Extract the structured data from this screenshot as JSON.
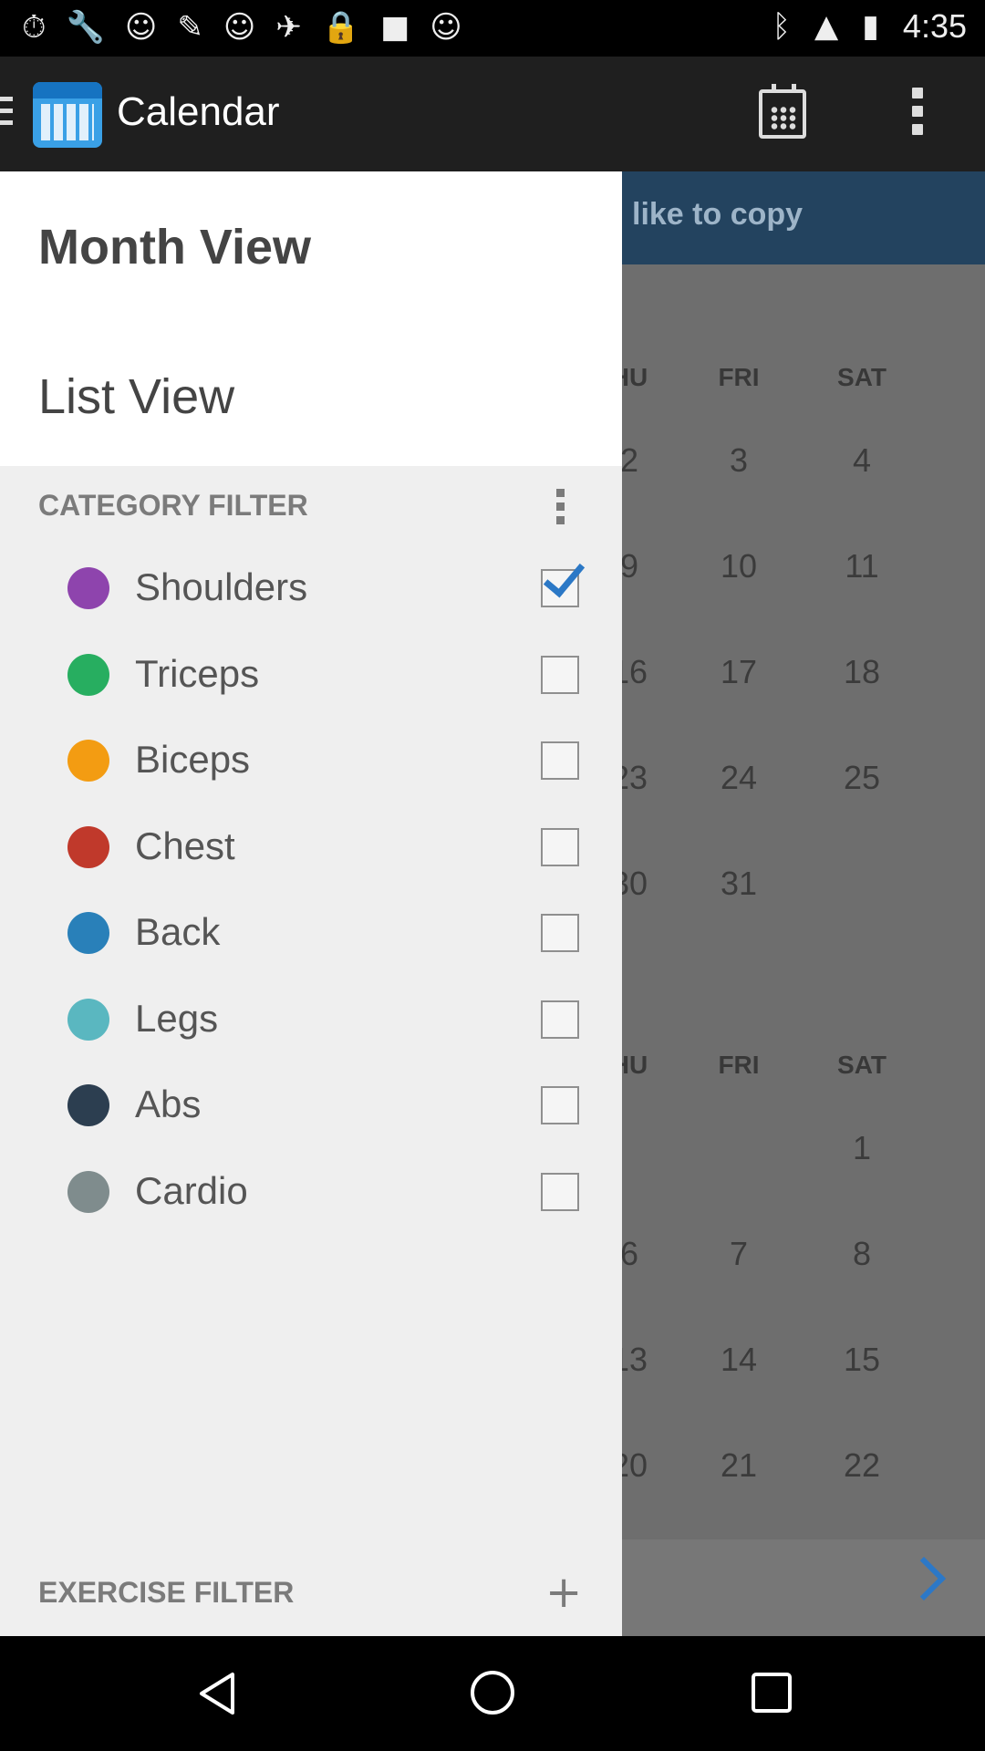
{
  "status_bar": {
    "time": "4:35",
    "icons": [
      "stopwatch-icon",
      "wrench-icon",
      "smiley-icon",
      "pin-icon",
      "smiley-icon",
      "satellite-icon",
      "lock-icon",
      "gamepad-icon",
      "smiley-icon",
      "bluetooth-icon",
      "signal-icon",
      "battery-icon"
    ]
  },
  "app_bar": {
    "title": "Calendar"
  },
  "background": {
    "banner_text": "like to copy",
    "week1": {
      "headers": [
        "HU",
        "FRI",
        "SAT"
      ],
      "rows": [
        [
          "2",
          "3",
          "4"
        ],
        [
          "9",
          "10",
          "11"
        ],
        [
          "16",
          "17",
          "18"
        ],
        [
          "23",
          "24",
          "25"
        ],
        [
          "30",
          "31",
          ""
        ]
      ]
    },
    "week2": {
      "headers": [
        "HU",
        "FRI",
        "SAT"
      ],
      "rows": [
        [
          "",
          "",
          "1"
        ],
        [
          "6",
          "7",
          "8"
        ],
        [
          "13",
          "14",
          "15"
        ],
        [
          "20",
          "21",
          "22"
        ]
      ]
    }
  },
  "drawer": {
    "month_view": "Month View",
    "list_view": "List View",
    "category_filter_title": "CATEGORY FILTER",
    "exercise_filter_title": "EXERCISE FILTER",
    "categories": [
      {
        "label": "Shoulders",
        "color": "#8e44ad",
        "checked": true
      },
      {
        "label": "Triceps",
        "color": "#27ae60",
        "checked": false
      },
      {
        "label": "Biceps",
        "color": "#f39c12",
        "checked": false
      },
      {
        "label": "Chest",
        "color": "#c0392b",
        "checked": false
      },
      {
        "label": "Back",
        "color": "#2980b9",
        "checked": false
      },
      {
        "label": "Legs",
        "color": "#5ab7c0",
        "checked": false
      },
      {
        "label": "Abs",
        "color": "#2c3e50",
        "checked": false
      },
      {
        "label": "Cardio",
        "color": "#7f8c8d",
        "checked": false
      }
    ]
  }
}
